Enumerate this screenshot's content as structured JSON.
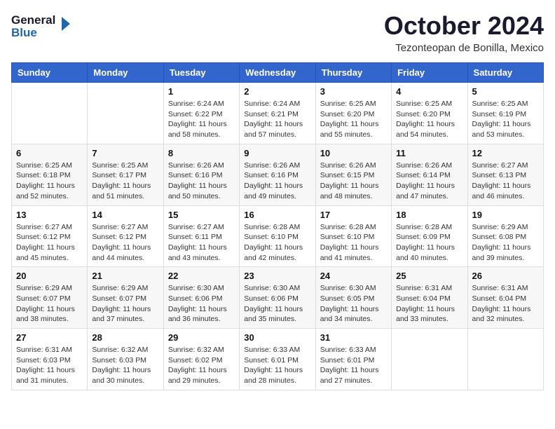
{
  "header": {
    "logo_general": "General",
    "logo_blue": "Blue",
    "month": "October 2024",
    "location": "Tezonteopan de Bonilla, Mexico"
  },
  "days_of_week": [
    "Sunday",
    "Monday",
    "Tuesday",
    "Wednesday",
    "Thursday",
    "Friday",
    "Saturday"
  ],
  "weeks": [
    [
      {
        "num": "",
        "detail": ""
      },
      {
        "num": "",
        "detail": ""
      },
      {
        "num": "1",
        "detail": "Sunrise: 6:24 AM\nSunset: 6:22 PM\nDaylight: 11 hours and 58 minutes."
      },
      {
        "num": "2",
        "detail": "Sunrise: 6:24 AM\nSunset: 6:21 PM\nDaylight: 11 hours and 57 minutes."
      },
      {
        "num": "3",
        "detail": "Sunrise: 6:25 AM\nSunset: 6:20 PM\nDaylight: 11 hours and 55 minutes."
      },
      {
        "num": "4",
        "detail": "Sunrise: 6:25 AM\nSunset: 6:20 PM\nDaylight: 11 hours and 54 minutes."
      },
      {
        "num": "5",
        "detail": "Sunrise: 6:25 AM\nSunset: 6:19 PM\nDaylight: 11 hours and 53 minutes."
      }
    ],
    [
      {
        "num": "6",
        "detail": "Sunrise: 6:25 AM\nSunset: 6:18 PM\nDaylight: 11 hours and 52 minutes."
      },
      {
        "num": "7",
        "detail": "Sunrise: 6:25 AM\nSunset: 6:17 PM\nDaylight: 11 hours and 51 minutes."
      },
      {
        "num": "8",
        "detail": "Sunrise: 6:26 AM\nSunset: 6:16 PM\nDaylight: 11 hours and 50 minutes."
      },
      {
        "num": "9",
        "detail": "Sunrise: 6:26 AM\nSunset: 6:16 PM\nDaylight: 11 hours and 49 minutes."
      },
      {
        "num": "10",
        "detail": "Sunrise: 6:26 AM\nSunset: 6:15 PM\nDaylight: 11 hours and 48 minutes."
      },
      {
        "num": "11",
        "detail": "Sunrise: 6:26 AM\nSunset: 6:14 PM\nDaylight: 11 hours and 47 minutes."
      },
      {
        "num": "12",
        "detail": "Sunrise: 6:27 AM\nSunset: 6:13 PM\nDaylight: 11 hours and 46 minutes."
      }
    ],
    [
      {
        "num": "13",
        "detail": "Sunrise: 6:27 AM\nSunset: 6:12 PM\nDaylight: 11 hours and 45 minutes."
      },
      {
        "num": "14",
        "detail": "Sunrise: 6:27 AM\nSunset: 6:12 PM\nDaylight: 11 hours and 44 minutes."
      },
      {
        "num": "15",
        "detail": "Sunrise: 6:27 AM\nSunset: 6:11 PM\nDaylight: 11 hours and 43 minutes."
      },
      {
        "num": "16",
        "detail": "Sunrise: 6:28 AM\nSunset: 6:10 PM\nDaylight: 11 hours and 42 minutes."
      },
      {
        "num": "17",
        "detail": "Sunrise: 6:28 AM\nSunset: 6:10 PM\nDaylight: 11 hours and 41 minutes."
      },
      {
        "num": "18",
        "detail": "Sunrise: 6:28 AM\nSunset: 6:09 PM\nDaylight: 11 hours and 40 minutes."
      },
      {
        "num": "19",
        "detail": "Sunrise: 6:29 AM\nSunset: 6:08 PM\nDaylight: 11 hours and 39 minutes."
      }
    ],
    [
      {
        "num": "20",
        "detail": "Sunrise: 6:29 AM\nSunset: 6:07 PM\nDaylight: 11 hours and 38 minutes."
      },
      {
        "num": "21",
        "detail": "Sunrise: 6:29 AM\nSunset: 6:07 PM\nDaylight: 11 hours and 37 minutes."
      },
      {
        "num": "22",
        "detail": "Sunrise: 6:30 AM\nSunset: 6:06 PM\nDaylight: 11 hours and 36 minutes."
      },
      {
        "num": "23",
        "detail": "Sunrise: 6:30 AM\nSunset: 6:06 PM\nDaylight: 11 hours and 35 minutes."
      },
      {
        "num": "24",
        "detail": "Sunrise: 6:30 AM\nSunset: 6:05 PM\nDaylight: 11 hours and 34 minutes."
      },
      {
        "num": "25",
        "detail": "Sunrise: 6:31 AM\nSunset: 6:04 PM\nDaylight: 11 hours and 33 minutes."
      },
      {
        "num": "26",
        "detail": "Sunrise: 6:31 AM\nSunset: 6:04 PM\nDaylight: 11 hours and 32 minutes."
      }
    ],
    [
      {
        "num": "27",
        "detail": "Sunrise: 6:31 AM\nSunset: 6:03 PM\nDaylight: 11 hours and 31 minutes."
      },
      {
        "num": "28",
        "detail": "Sunrise: 6:32 AM\nSunset: 6:03 PM\nDaylight: 11 hours and 30 minutes."
      },
      {
        "num": "29",
        "detail": "Sunrise: 6:32 AM\nSunset: 6:02 PM\nDaylight: 11 hours and 29 minutes."
      },
      {
        "num": "30",
        "detail": "Sunrise: 6:33 AM\nSunset: 6:01 PM\nDaylight: 11 hours and 28 minutes."
      },
      {
        "num": "31",
        "detail": "Sunrise: 6:33 AM\nSunset: 6:01 PM\nDaylight: 11 hours and 27 minutes."
      },
      {
        "num": "",
        "detail": ""
      },
      {
        "num": "",
        "detail": ""
      }
    ]
  ]
}
